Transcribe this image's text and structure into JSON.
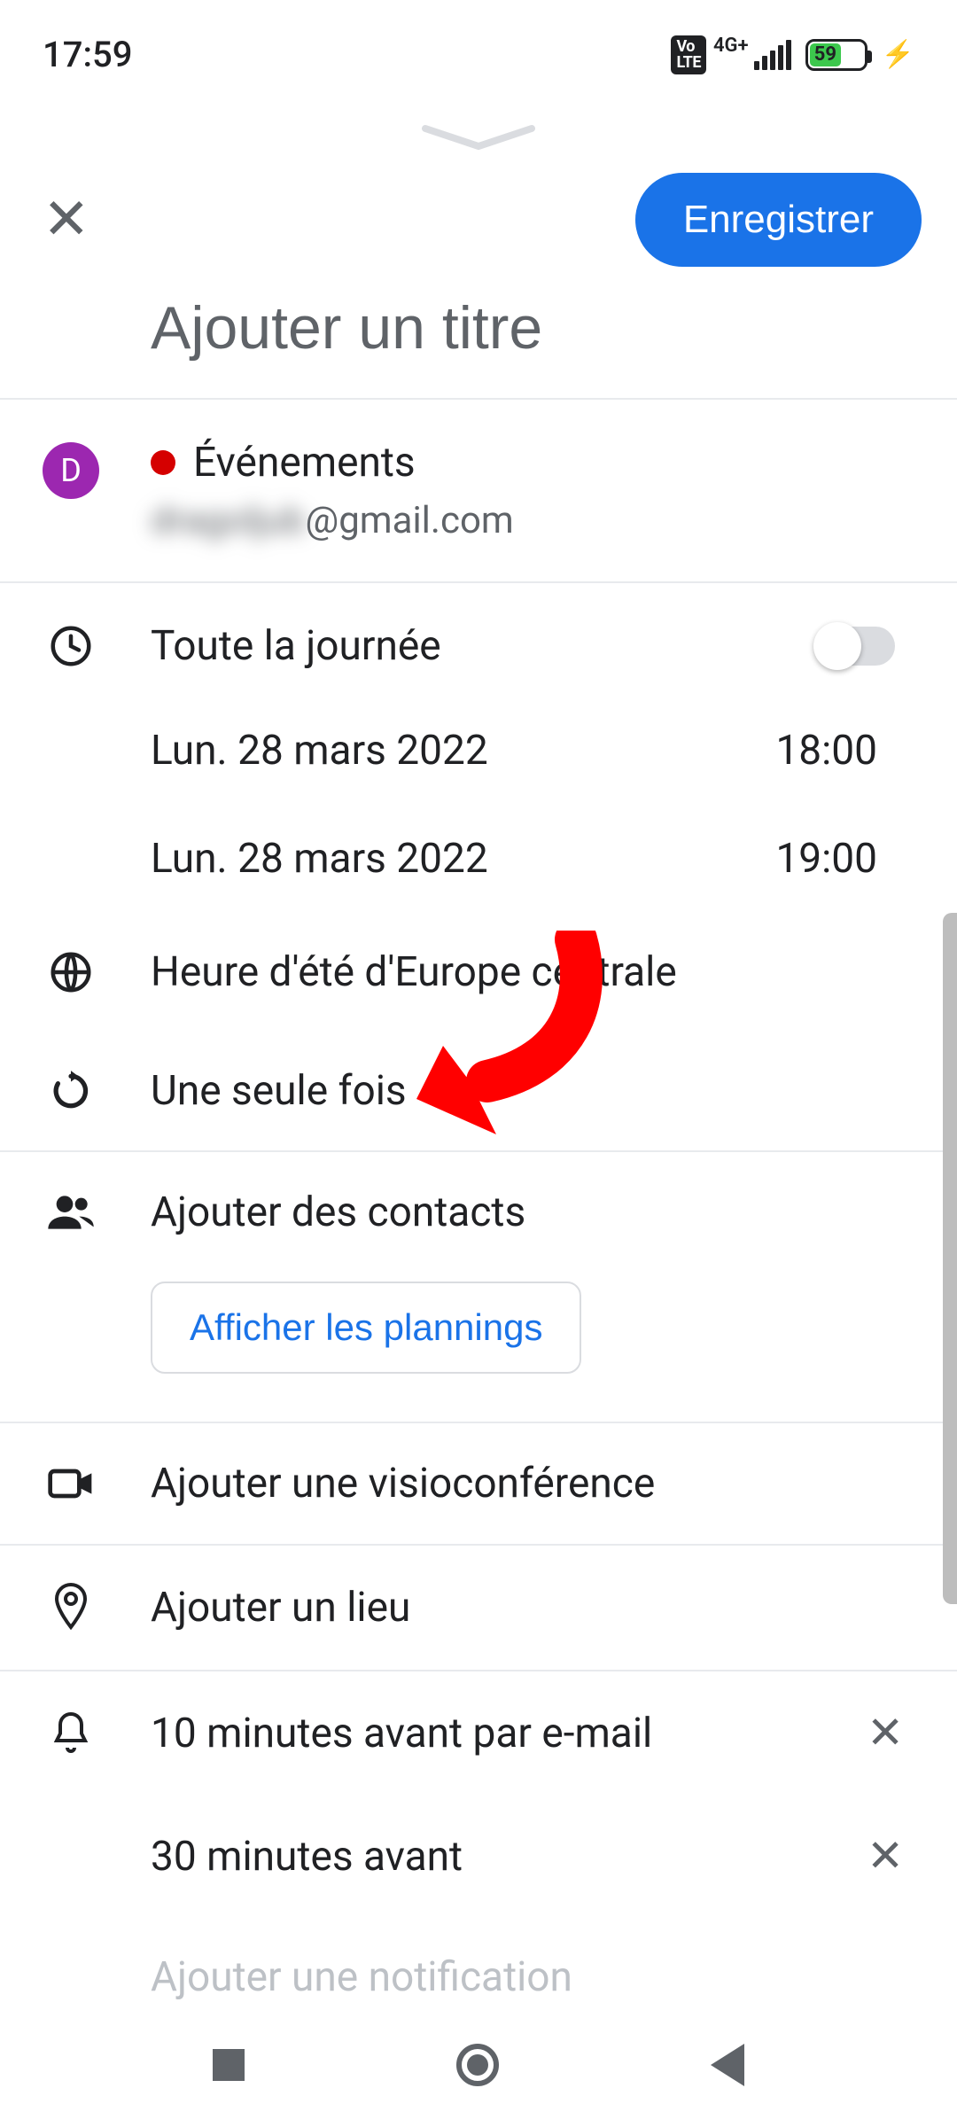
{
  "status": {
    "time": "17:59",
    "network": "4G+",
    "volte": "Vo LTE",
    "battery": "59"
  },
  "appbar": {
    "save": "Enregistrer"
  },
  "title": {
    "placeholder": "Ajouter un titre"
  },
  "calendar": {
    "avatar_letter": "D",
    "name": "Événements",
    "email_prefix": "dragoljub",
    "email_suffix": "@gmail.com"
  },
  "allday": {
    "label": "Toute la journée",
    "on": false
  },
  "start": {
    "date": "Lun. 28 mars 2022",
    "time": "18:00"
  },
  "end": {
    "date": "Lun. 28 mars 2022",
    "time": "19:00"
  },
  "timezone": "Heure d'été d'Europe centrale",
  "recurrence": "Une seule fois",
  "contacts": {
    "add": "Ajouter des contacts",
    "show_schedules": "Afficher les plannings"
  },
  "video": "Ajouter une visioconférence",
  "location": "Ajouter un lieu",
  "notifications": [
    "10 minutes avant par e-mail",
    "30 minutes avant"
  ],
  "add_notification": "Ajouter une notification",
  "annotation": {
    "arrow_target": "recurrence-row"
  }
}
